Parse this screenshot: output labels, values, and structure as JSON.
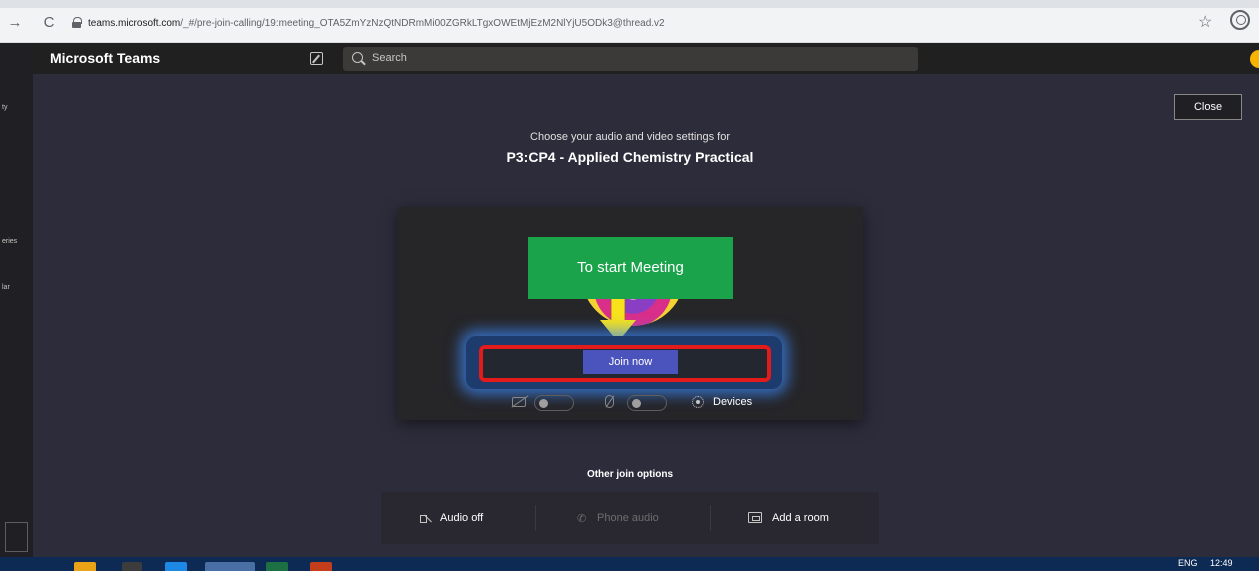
{
  "browser": {
    "url_host": "teams.microsoft.com",
    "url_path": "/_#/pre-join-calling/19:meeting_OTA5ZmYzNzQtNDRmMi00ZGRkLTgxOWEtMjEzM2NlYjU5ODk3@thread.v2",
    "nav_back": "→",
    "nav_reload": "C",
    "star": "☆"
  },
  "header": {
    "app_title": "Microsoft Teams",
    "search_placeholder": "Search"
  },
  "left_rail": {
    "fragments": [
      "ty",
      "eries",
      "lar"
    ]
  },
  "main": {
    "close_label": "Close",
    "subtitle": "Choose your audio and video settings for",
    "meeting_title": "P3:CP4 - Applied Chemistry Practical",
    "annotation_label": "To start Meeting",
    "join_label": "Join now",
    "devices_label": "Devices",
    "other_options_title": "Other join options",
    "options": {
      "audio_off": "Audio off",
      "phone_audio": "Phone audio",
      "add_room": "Add a room"
    }
  },
  "taskbar": {
    "lang": "ENG",
    "time": "12:49"
  },
  "colors": {
    "accent": "#4b53bc",
    "callout": "#1aa34a",
    "highlight": "#e31b1b",
    "arrow": "#f7e21b"
  }
}
